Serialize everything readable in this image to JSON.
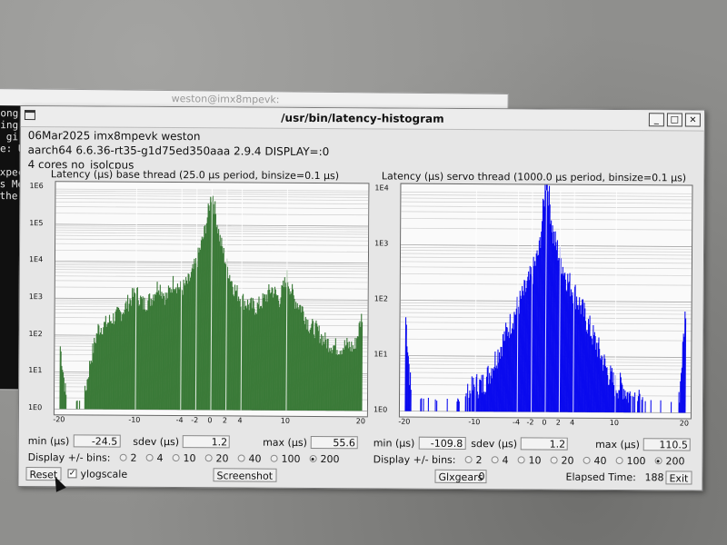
{
  "background_terminal": {
    "title": "weston@imx8mpevk:",
    "lines": [
      "ong",
      "ing",
      " gi",
      "e: U",
      "",
      "xpec",
      "s Me",
      "the"
    ]
  },
  "window": {
    "title": "/usr/bin/latency-histogram",
    "info_line1": "06Mar2025 imx8mpevk weston",
    "info_line2": "aarch64  6.6.36-rt35-g1d75ed350aaa  2.9.4  DISPLAY=:0",
    "info_line3": "4 cores  no_isolcpus",
    "minimize": "_",
    "maximize": "□",
    "close": "×"
  },
  "base": {
    "title": "Latency (µs) base thread (25.0 µs period, binsize=0.1 µs)",
    "min_label": "min (µs)",
    "min": "-24.5",
    "sdev_label": "sdev (µs)",
    "sdev": "1.2",
    "max_label": "max (µs)",
    "max": "55.6",
    "color": "#3b7a38"
  },
  "servo": {
    "title": "Latency (µs) servo thread (1000.0 µs period, binsize=0.1 µs)",
    "min_label": "min (µs)",
    "min": "-109.8",
    "sdev_label": "sdev (µs)",
    "sdev": "1.2",
    "max_label": "max (µs)",
    "max": "110.5",
    "color": "#0a0aee"
  },
  "bins": {
    "label": "Display +/- bins:",
    "options": [
      "2",
      "4",
      "10",
      "20",
      "40",
      "100",
      "200"
    ],
    "selected": "200"
  },
  "x_ticks": [
    "-20",
    "-10",
    "-4",
    "-2",
    "0",
    "2",
    "4",
    "10",
    "20"
  ],
  "y_ticks_base": [
    "1E6",
    "1E5",
    "1E4",
    "1E3",
    "1E2",
    "1E1",
    "1E0"
  ],
  "y_ticks_servo": [
    "1E4",
    "1E3",
    "1E2",
    "1E1",
    "1E0"
  ],
  "bottom": {
    "reset": "Reset",
    "ylogscale": "ylogscale",
    "screenshot": "Screenshot",
    "glxgears": "Glxgears",
    "glxgears_count": "0",
    "elapsed_label": "Elapsed Time:",
    "elapsed_value": "188",
    "exit": "Exit"
  },
  "chart_data": [
    {
      "type": "bar",
      "title": "Latency (µs) base thread (25.0 µs period, binsize=0.1 µs)",
      "xlabel": "",
      "ylabel": "",
      "xlim": [
        -20,
        20
      ],
      "y_scale": "log",
      "ylim": [
        1,
        1000000
      ],
      "grid": true,
      "x": [
        -20,
        -19,
        -18,
        -17,
        -16,
        -15,
        -14,
        -13,
        -12,
        -11,
        -10,
        -9,
        -8,
        -7,
        -6,
        -5,
        -4,
        -3,
        -2,
        -1,
        0,
        1,
        2,
        3,
        4,
        5,
        6,
        7,
        8,
        9,
        10,
        11,
        12,
        13,
        14,
        15,
        16,
        17,
        18,
        19,
        20
      ],
      "values": [
        50,
        1,
        1,
        1,
        20,
        150,
        200,
        300,
        400,
        800,
        1500,
        700,
        1000,
        2500,
        1000,
        3000,
        1800,
        3000,
        10000,
        60000,
        800000,
        50000,
        8000,
        2000,
        1000,
        700,
        600,
        1000,
        2000,
        1000,
        4000,
        1000,
        600,
        200,
        150,
        80,
        60,
        50,
        60,
        50,
        400
      ]
    },
    {
      "type": "bar",
      "title": "Latency (µs) servo thread (1000.0 µs period, binsize=0.1 µs)",
      "xlabel": "",
      "ylabel": "",
      "xlim": [
        -20,
        20
      ],
      "y_scale": "log",
      "ylim": [
        1,
        10000
      ],
      "grid": true,
      "x": [
        -20,
        -19,
        -18,
        -17,
        -16,
        -15,
        -14,
        -13,
        -12,
        -11,
        -10,
        -9,
        -8,
        -7,
        -6,
        -5,
        -4,
        -3,
        -2,
        -1,
        0,
        1,
        2,
        3,
        4,
        5,
        6,
        7,
        8,
        9,
        10,
        11,
        12,
        13,
        14,
        15,
        16,
        17,
        18,
        19,
        20
      ],
      "values": [
        50,
        1,
        1,
        1,
        1,
        1,
        1,
        1,
        1,
        2,
        3,
        3,
        5,
        10,
        20,
        40,
        80,
        150,
        300,
        800,
        20000,
        1500,
        600,
        250,
        150,
        80,
        40,
        20,
        10,
        5,
        3,
        3,
        2,
        2,
        1,
        1,
        1,
        1,
        1,
        1,
        80
      ]
    }
  ]
}
